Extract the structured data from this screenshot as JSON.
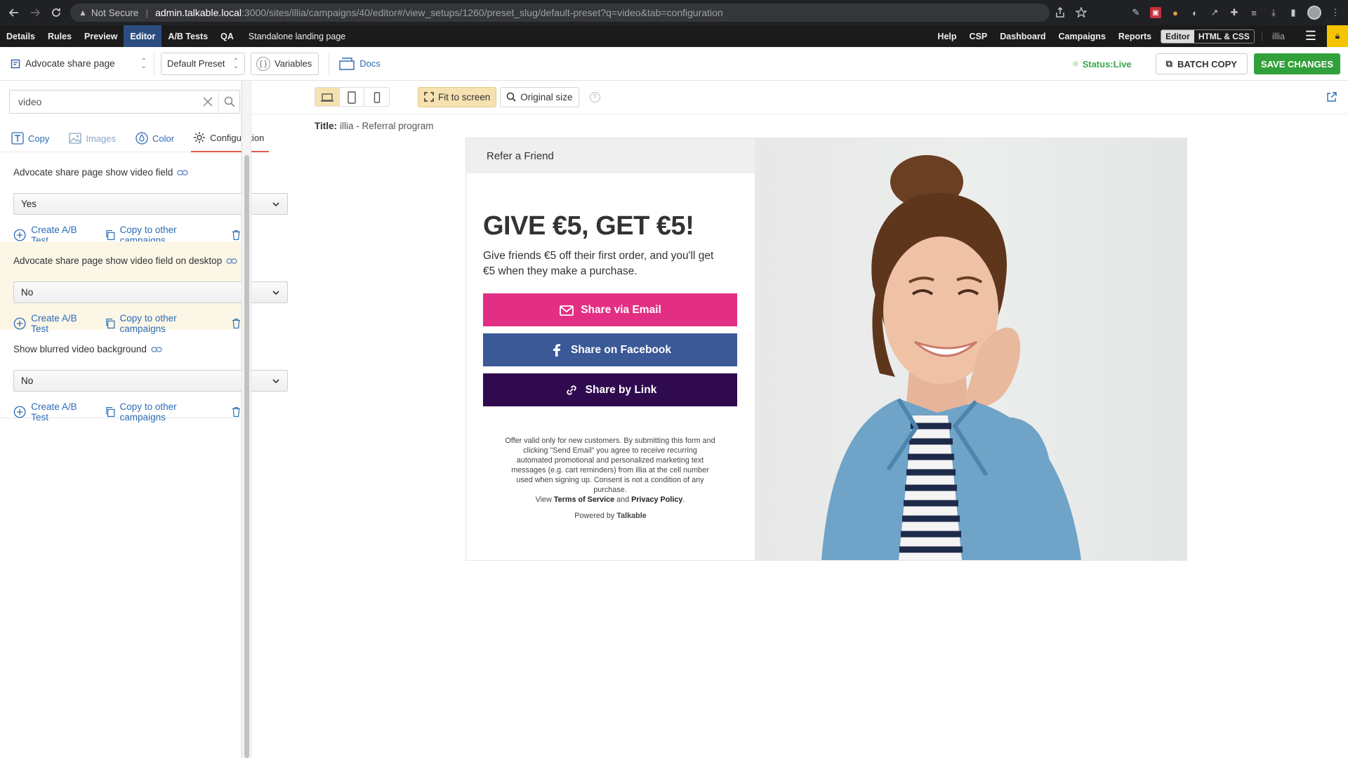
{
  "browser": {
    "not_secure": "Not Secure",
    "url_host": "admin.talkable.local",
    "url_path": ":3000/sites/illia/campaigns/40/editor#/view_setups/1260/preset_slug/default-preset?q=video&tab=configuration"
  },
  "appnav": {
    "left": [
      "Details",
      "Rules",
      "Preview",
      "Editor",
      "A/B Tests",
      "QA"
    ],
    "crumb": "Standalone landing page",
    "right": [
      "Help",
      "CSP",
      "Dashboard",
      "Campaigns",
      "Reports"
    ],
    "mode_on": "Editor",
    "mode_off": "HTML & CSS",
    "user": "illia"
  },
  "toolbar": {
    "page": "Advocate share page",
    "preset": "Default Preset",
    "variables": "Variables",
    "docs": "Docs",
    "status": "Status:Live",
    "batch": "BATCH COPY",
    "save": "SAVE CHANGES"
  },
  "sidebar": {
    "search_value": "video",
    "tabs": [
      "Copy",
      "Images",
      "Color",
      "Configuration"
    ],
    "fields": [
      {
        "title": "Advocate share page show video field",
        "value": "Yes"
      },
      {
        "title": "Advocate share page show video field on desktop",
        "value": "No"
      },
      {
        "title": "Show blurred video background",
        "value": "No"
      }
    ],
    "create_ab": "Create A/B Test",
    "copy_other": "Copy to other campaigns"
  },
  "preview": {
    "fit": "Fit to screen",
    "original": "Original size",
    "help": "?",
    "title_label": "Title:",
    "title_value": "illia - Referral program"
  },
  "landing": {
    "header": "Refer a Friend",
    "headline": "GIVE €5, GET €5!",
    "subtext": "Give friends €5 off their first order, and you'll get €5 when they make a purchase.",
    "email_btn": "Share via Email",
    "facebook_btn": "Share on Facebook",
    "link_btn": "Share by Link",
    "legal": "Offer valid only for new customers. By submitting this form and clicking \"Send Email\" you agree to receive recurring automated promotional and personalized marketing text messages (e.g. cart reminders) from illia at the cell number used when signing up. Consent is not a condition of any purchase.",
    "view": "View",
    "terms": "Terms of Service",
    "and": "and",
    "privacy": "Privacy Policy",
    "period": ".",
    "powered": "Powered by",
    "brand": "Talkable"
  },
  "colors": {
    "email": "#e22f83",
    "facebook": "#3a5996",
    "link": "#2f0a4f",
    "save": "#32a13b",
    "accent": "#2d6bb5"
  }
}
